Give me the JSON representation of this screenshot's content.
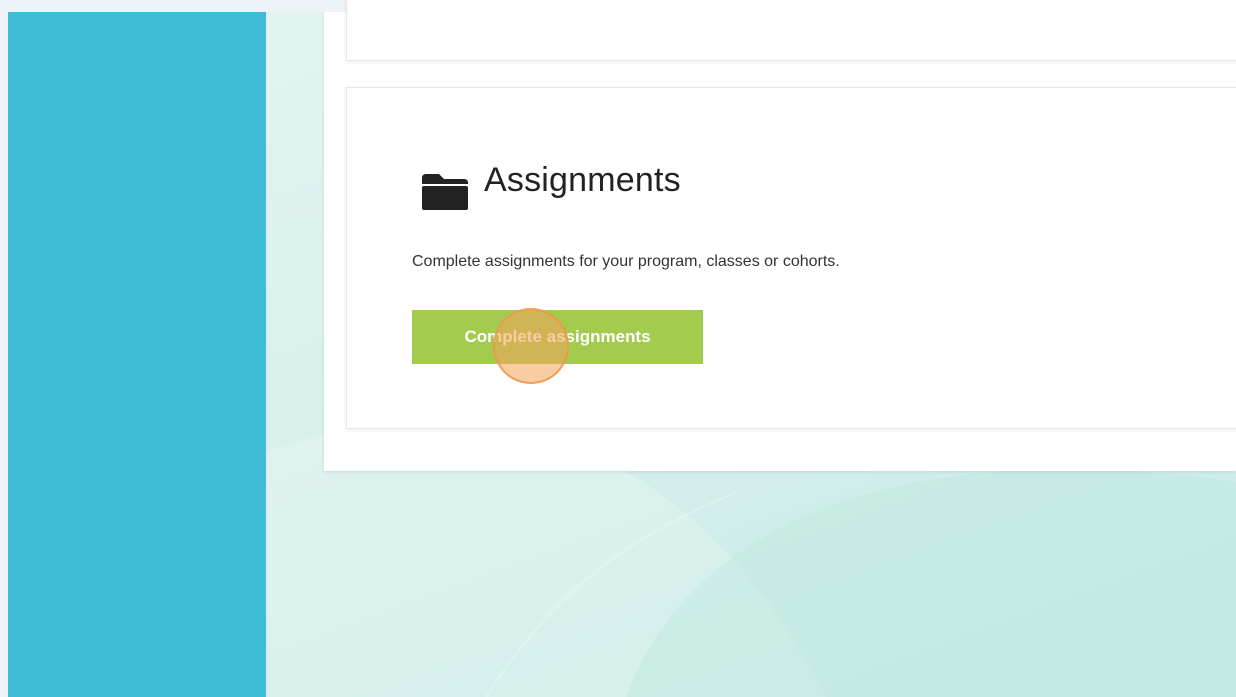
{
  "assignments": {
    "icon": "folder-icon",
    "title": "Assignments",
    "description": "Complete assignments for your program, classes or cohorts.",
    "button_label": "Complete assignments"
  },
  "colors": {
    "sidebar": "#41bdd8",
    "button": "#a3cc4f",
    "click_marker": "#f4a259"
  }
}
